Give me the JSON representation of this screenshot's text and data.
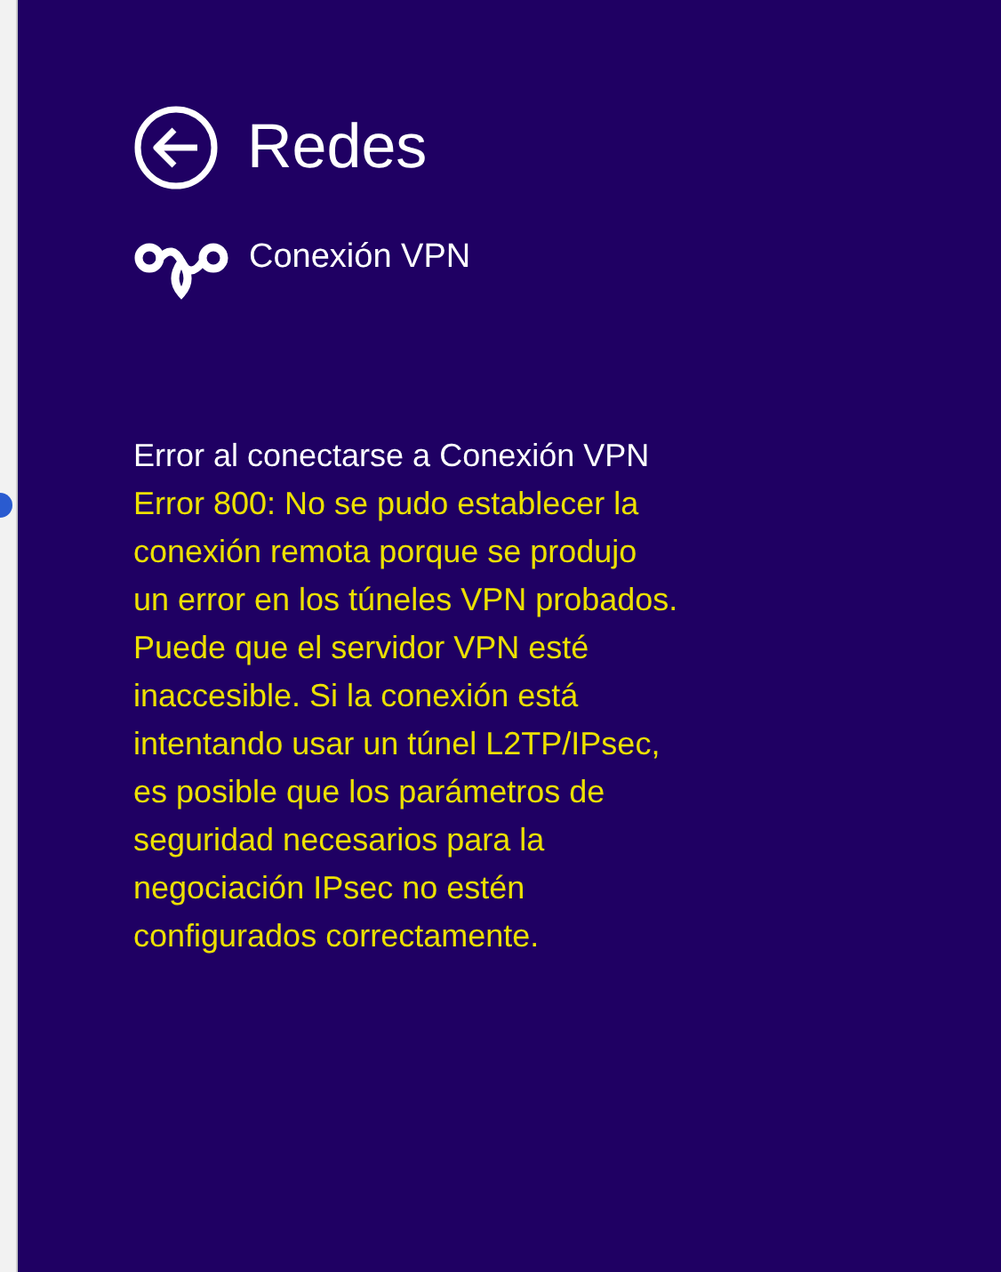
{
  "header": {
    "title": "Redes"
  },
  "connection": {
    "name": "Conexión VPN"
  },
  "error": {
    "title": "Error al conectarse a Conexión VPN",
    "lines": [
      "Error 800: No se pudo establecer la",
      "conexión remota porque se produjo",
      "un error en los túneles VPN probados.",
      "Puede que el servidor VPN esté",
      "inaccesible. Si la conexión está",
      "intentando usar un túnel L2TP/IPsec,",
      "es posible que los parámetros de",
      "seguridad necesarios para la",
      "negociación IPsec no estén",
      "configurados correctamente."
    ]
  }
}
